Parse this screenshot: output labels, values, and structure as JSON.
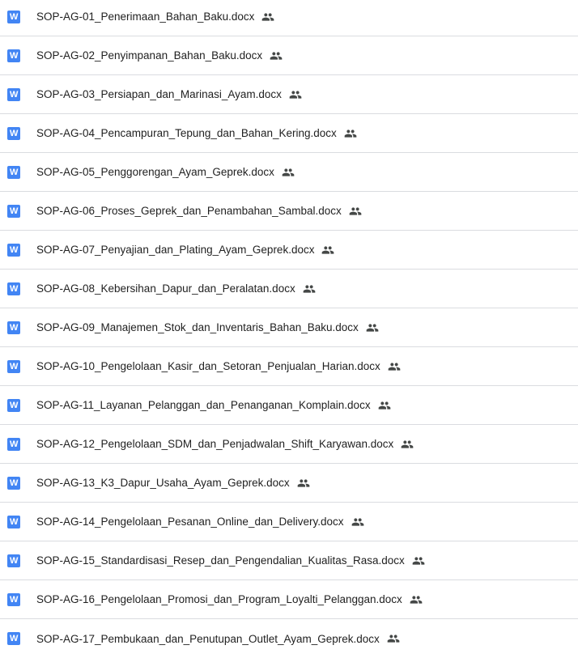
{
  "files": [
    {
      "name": "SOP-AG-01_Penerimaan_Bahan_Baku.docx",
      "icon": "word-doc-icon",
      "shared": true
    },
    {
      "name": "SOP-AG-02_Penyimpanan_Bahan_Baku.docx",
      "icon": "word-doc-icon",
      "shared": true
    },
    {
      "name": "SOP-AG-03_Persiapan_dan_Marinasi_Ayam.docx",
      "icon": "word-doc-icon",
      "shared": true
    },
    {
      "name": "SOP-AG-04_Pencampuran_Tepung_dan_Bahan_Kering.docx",
      "icon": "word-doc-icon",
      "shared": true
    },
    {
      "name": "SOP-AG-05_Penggorengan_Ayam_Geprek.docx",
      "icon": "word-doc-icon",
      "shared": true
    },
    {
      "name": "SOP-AG-06_Proses_Geprek_dan_Penambahan_Sambal.docx",
      "icon": "word-doc-icon",
      "shared": true
    },
    {
      "name": "SOP-AG-07_Penyajian_dan_Plating_Ayam_Geprek.docx",
      "icon": "word-doc-icon",
      "shared": true
    },
    {
      "name": "SOP-AG-08_Kebersihan_Dapur_dan_Peralatan.docx",
      "icon": "word-doc-icon",
      "shared": true
    },
    {
      "name": "SOP-AG-09_Manajemen_Stok_dan_Inventaris_Bahan_Baku.docx",
      "icon": "word-doc-icon",
      "shared": true
    },
    {
      "name": "SOP-AG-10_Pengelolaan_Kasir_dan_Setoran_Penjualan_Harian.docx",
      "icon": "word-doc-icon",
      "shared": true
    },
    {
      "name": "SOP-AG-11_Layanan_Pelanggan_dan_Penanganan_Komplain.docx",
      "icon": "word-doc-icon",
      "shared": true
    },
    {
      "name": "SOP-AG-12_Pengelolaan_SDM_dan_Penjadwalan_Shift_Karyawan.docx",
      "icon": "word-doc-icon",
      "shared": true
    },
    {
      "name": "SOP-AG-13_K3_Dapur_Usaha_Ayam_Geprek.docx",
      "icon": "word-doc-icon",
      "shared": true
    },
    {
      "name": "SOP-AG-14_Pengelolaan_Pesanan_Online_dan_Delivery.docx",
      "icon": "word-doc-icon",
      "shared": true
    },
    {
      "name": "SOP-AG-15_Standardisasi_Resep_dan_Pengendalian_Kualitas_Rasa.docx",
      "icon": "word-doc-icon",
      "shared": true
    },
    {
      "name": "SOP-AG-16_Pengelolaan_Promosi_dan_Program_Loyalti_Pelanggan.docx",
      "icon": "word-doc-icon",
      "shared": true
    },
    {
      "name": "SOP-AG-17_Pembukaan_dan_Penutupan_Outlet_Ayam_Geprek.docx",
      "icon": "word-doc-icon",
      "shared": true
    }
  ],
  "icons": {
    "word_letter": "W",
    "word_color": "#4285f4",
    "shared_color": "#444746"
  }
}
